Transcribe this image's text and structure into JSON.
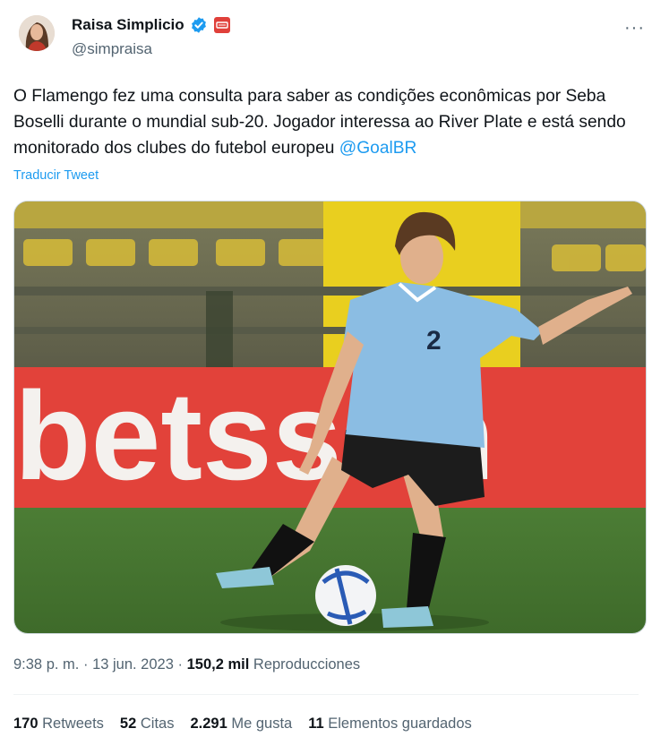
{
  "author": {
    "name": "Raisa Simplicio",
    "handle": "@simpraisa"
  },
  "tweet": {
    "text": "O Flamengo fez uma consulta para saber as condições econômicas por Seba Boselli durante o mundial sub-20. Jogador interessa ao River Plate e está sendo monitorado dos clubes do futebol europeu ",
    "mention": "@GoalBR",
    "translate_label": "Traducir Tweet"
  },
  "media": {
    "banner_text": "betsson",
    "player_number": "2"
  },
  "meta": {
    "time": "9:38 p. m.",
    "sep1": "·",
    "date": "13 jun. 2023",
    "sep2": "·",
    "views": "150,2 mil",
    "views_label": "Reproducciones"
  },
  "stats": {
    "retweets": "170",
    "retweets_label": "Retweets",
    "quotes": "52",
    "quotes_label": "Citas",
    "likes": "2.291",
    "likes_label": "Me gusta",
    "bookmarks": "11",
    "bookmarks_label": "Elementos guardados"
  },
  "colors": {
    "link": "#1d9bf0",
    "secondary": "#536471",
    "verified": "#1d9bf0"
  }
}
